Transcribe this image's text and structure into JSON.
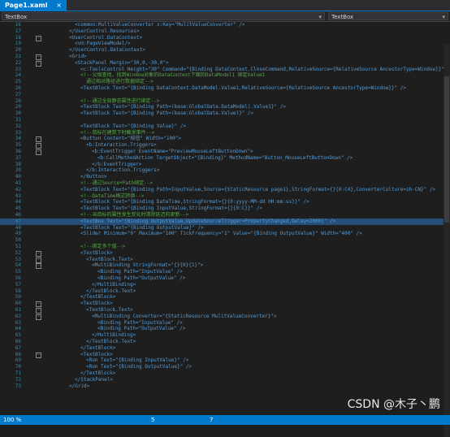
{
  "tab": {
    "title": "Page1.xaml",
    "close": "×"
  },
  "nav": {
    "left": "TextBox",
    "right": "TextBox"
  },
  "editor": {
    "lines": [
      {
        "n": "16",
        "code": "<common:MultiValueConverter x:Key=\"MulitValueConverter\" />"
      },
      {
        "n": "17",
        "code": "</UserControl.Resources>"
      },
      {
        "n": "18",
        "code": "<UserControl.DataContext>"
      },
      {
        "n": "19",
        "code": "<vm:PageViewModel/>"
      },
      {
        "n": "20",
        "code": "</UserControl.DataContext>"
      },
      {
        "n": "21",
        "code": "<Grid>"
      },
      {
        "n": "22",
        "code": "<StackPanel Margin=\"30,0,-30,0\">"
      },
      {
        "n": "23",
        "code": "<c:ToolsControl Height=\"30\" Command=\"{Binding DataContext.CloseCommand,RelativeSource={RelativeSource AncestorType=Window}}\" />"
      },
      {
        "n": "24",
        "code": "<!--父级查找，找到Window对象的DataContext下面的DataModel1 绑定Value1"
      },
      {
        "n": "25",
        "code": "通过相对路径进行数据绑定-->"
      },
      {
        "n": "26",
        "code": "<TextBlock Text=\"{Binding DataContext.DataModel.Value1,RelativeSource={RelativeSource AncestorType=Window}}\" />"
      },
      {
        "n": "27",
        "code": ""
      },
      {
        "n": "28",
        "code": "<!--通过全局静态属性进行绑定-->"
      },
      {
        "n": "29",
        "code": "<TextBlock Text=\"{Binding Path=(base:GlobalData.DataModel).Value1}\" />"
      },
      {
        "n": "30",
        "code": "<TextBlock Text=\"{Binding Path=(base:GlobalData.Value)}\" />"
      },
      {
        "n": "31",
        "code": ""
      },
      {
        "n": "32",
        "code": "<TextBlock Text=\"{Binding Value}\" />"
      },
      {
        "n": "33",
        "code": "<!--鼠标在建筑下时触发事件-->"
      },
      {
        "n": "34",
        "code": "<Button Content=\"按钮\" Width=\"100\">"
      },
      {
        "n": "35",
        "code": "<b:Interaction.Triggers>"
      },
      {
        "n": "36",
        "code": "<b:EventTrigger EventName=\"PreviewMouseLeftButtonDown\">"
      },
      {
        "n": "37",
        "code": "<b:CallMethodAction TargetObject=\"{Binding}\" MethodName=\"Button_MouseLeftButtonDown\" />"
      },
      {
        "n": "38",
        "code": "</b:EventTrigger>"
      },
      {
        "n": "39",
        "code": "</b:Interaction.Triggers>"
      },
      {
        "n": "40",
        "code": "</Button>"
      },
      {
        "n": "41",
        "code": "<!--通过Source+Path绑定-->"
      },
      {
        "n": "42",
        "code": "<TextBlock Text=\"{Binding Path=InputValue,Source={StaticResource page1},StringFormat={}{0:C4},ConverterCulture=zh-CN}\" />"
      },
      {
        "n": "43",
        "code": "<!--DateTime格式转换-->"
      },
      {
        "n": "44",
        "code": "<TextBlock Text=\"{Binding DateTime,StringFormat={}{0:yyyy-MM-dd HH:mm:ss}}\" />"
      },
      {
        "n": "45",
        "code": "<TextBlock Text=\"{Binding InputValue,StringFormat={}{0:C}}\" />"
      },
      {
        "n": "46",
        "code": "<!--当目标的属性发生变化时清除延迟的更新-->"
      },
      {
        "n": "47",
        "code": "<TextBox Text=\"{Binding OutputValue,UpdateSourceTrigger=PropertyChanged,Delay=2000}\" />"
      },
      {
        "n": "48",
        "code": "<TextBlock Text=\"{Binding OutputValue}\" />"
      },
      {
        "n": "49",
        "code": "<Slider Minimum=\"0\" Maximum=\"100\" TickFrequency=\"1\" Value=\"{Binding OutputValue}\" Width=\"400\" />"
      },
      {
        "n": "50",
        "code": ""
      },
      {
        "n": "51",
        "code": "<!--绑定多个值-->"
      },
      {
        "n": "52",
        "code": "<TextBlock>"
      },
      {
        "n": "53",
        "code": "<TextBlock.Text>"
      },
      {
        "n": "54",
        "code": "<MultiBinding StringFormat=\"{}{0}{1}\">"
      },
      {
        "n": "55",
        "code": "<Binding Path=\"InputValue\" />"
      },
      {
        "n": "56",
        "code": "<Binding Path=\"OutputValue\" />"
      },
      {
        "n": "57",
        "code": "</MultiBinding>"
      },
      {
        "n": "58",
        "code": "</TextBlock.Text>"
      },
      {
        "n": "59",
        "code": "</TextBlock>"
      },
      {
        "n": "60",
        "code": "<TextBlock>"
      },
      {
        "n": "61",
        "code": "<TextBlock.Text>"
      },
      {
        "n": "62",
        "code": "<MultiBinding Converter=\"{StaticResource MulitValueConverter}\">"
      },
      {
        "n": "63",
        "code": "<Binding Path=\"InputValue\" />"
      },
      {
        "n": "64",
        "code": "<Binding Path=\"OutputValue\" />"
      },
      {
        "n": "65",
        "code": "</MultiBinding>"
      },
      {
        "n": "66",
        "code": "</TextBlock.Text>"
      },
      {
        "n": "67",
        "code": "</TextBlock>"
      },
      {
        "n": "68",
        "code": "<TextBlock>"
      },
      {
        "n": "69",
        "code": "<Run Text=\"{Binding InputValue}\" />"
      },
      {
        "n": "70",
        "code": "<Run Text=\"{Binding OutputValue}\" />"
      },
      {
        "n": "71",
        "code": "</TextBlock>"
      },
      {
        "n": "72",
        "code": "</StackPanel>"
      },
      {
        "n": "73",
        "code": "</Grid>"
      }
    ],
    "highlighted_line": "47"
  },
  "status": {
    "zoom": "100 %",
    "col": "5",
    "ch": "7"
  },
  "watermark": "CSDN @木子丶鹏"
}
